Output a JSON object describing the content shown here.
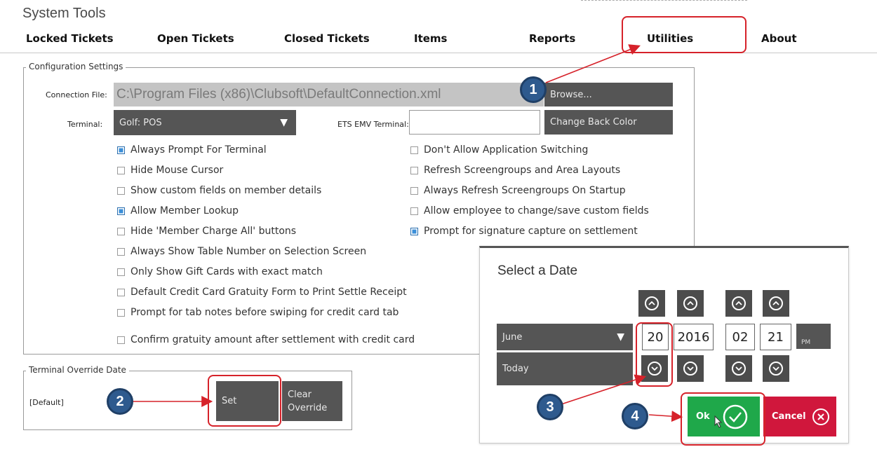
{
  "window": {
    "title": "System Tools"
  },
  "tabs": [
    {
      "label": "Locked Tickets"
    },
    {
      "label": "Open Tickets"
    },
    {
      "label": "Closed Tickets"
    },
    {
      "label": "Items"
    },
    {
      "label": "Reports"
    },
    {
      "label": "Utilities"
    },
    {
      "label": "About"
    }
  ],
  "config": {
    "legend": "Configuration Settings",
    "connection_label": "Connection File:",
    "connection_value": "C:\\Program Files (x86)\\Clubsoft\\DefaultConnection.xml",
    "browse_label": "Browse...",
    "terminal_label": "Terminal:",
    "terminal_value": "Golf: POS",
    "ets_label": "ETS EMV Terminal:",
    "ets_value": "",
    "change_back_color_label": "Change Back Color",
    "left_checks": [
      {
        "label": "Always Prompt For Terminal",
        "checked": true
      },
      {
        "label": "Hide Mouse Cursor",
        "checked": false
      },
      {
        "label": "Show custom fields on member details",
        "checked": false
      },
      {
        "label": "Allow Member Lookup",
        "checked": true
      },
      {
        "label": "Hide 'Member Charge All' buttons",
        "checked": false
      },
      {
        "label": "Always Show Table Number on Selection Screen",
        "checked": false
      },
      {
        "label": "Only Show Gift Cards with exact match",
        "checked": false
      },
      {
        "label": "Default Credit Card Gratuity Form to Print Settle Receipt",
        "checked": false
      },
      {
        "label": "Prompt for tab notes before swiping for credit card tab",
        "checked": false
      },
      {
        "label": "Confirm gratuity amount after settlement with credit card",
        "checked": false
      }
    ],
    "right_checks": [
      {
        "label": "Don't Allow Application Switching",
        "checked": false
      },
      {
        "label": "Refresh Screengroups and Area Layouts",
        "checked": false
      },
      {
        "label": "Always Refresh Screengroups On Startup",
        "checked": false
      },
      {
        "label": "Allow employee to change/save custom fields",
        "checked": false
      },
      {
        "label": "Prompt for signature capture on settlement",
        "checked": true
      }
    ]
  },
  "override": {
    "legend": "Terminal Override Date",
    "value": "[Default]",
    "set_label": "Set",
    "clear_line1": "Clear",
    "clear_line2": "Override"
  },
  "date_dialog": {
    "title": "Select a Date",
    "month": "June",
    "today_label": "Today",
    "day": "20",
    "year": "2016",
    "hour": "02",
    "minute": "21",
    "ampm": "PM",
    "ok_label": "Ok",
    "cancel_label": "Cancel"
  },
  "callouts": [
    "1",
    "2",
    "3",
    "4"
  ],
  "colors": {
    "annotation_red": "#d6222a",
    "badge_blue": "#2e5a8e",
    "ok_green": "#1fa84a",
    "cancel_red": "#d0173c",
    "dark_button": "#555555",
    "checked_blue": "#3b8fd9"
  },
  "icons": {
    "chevron_up": "up-chevron-icon",
    "chevron_down": "down-chevron-icon",
    "dropdown": "dropdown-triangle-icon",
    "ok": "checkmark-circle-icon",
    "cancel": "x-circle-icon",
    "cursor": "mouse-cursor-icon"
  }
}
